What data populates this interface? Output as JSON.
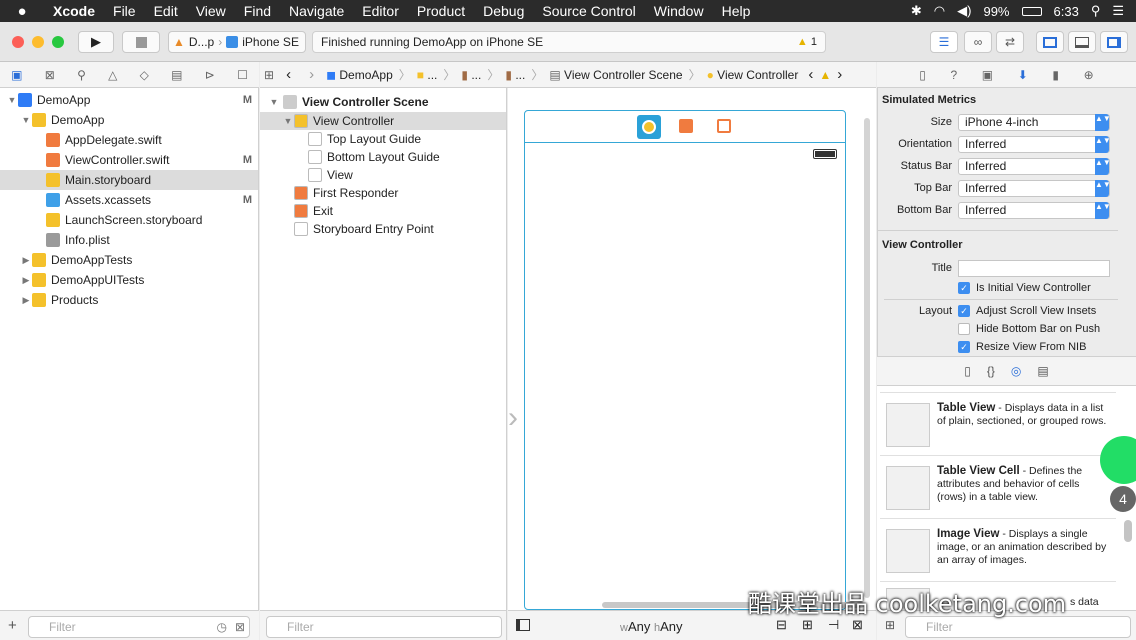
{
  "menubar": {
    "app": "Xcode",
    "items": [
      "File",
      "Edit",
      "View",
      "Find",
      "Navigate",
      "Editor",
      "Product",
      "Debug",
      "Source Control",
      "Window",
      "Help"
    ],
    "battery": "99%",
    "time": "6:33"
  },
  "toolbar": {
    "scheme": "D...p",
    "device": "iPhone SE",
    "status": "Finished running DemoApp on iPhone SE",
    "warnings": "1"
  },
  "navigator": {
    "items": [
      {
        "label": "DemoApp",
        "badge": "M",
        "indent": 0,
        "tri": "▼",
        "icon": "#2f7cf6"
      },
      {
        "label": "DemoApp",
        "badge": "",
        "indent": 1,
        "tri": "▼",
        "icon": "#f4c12b"
      },
      {
        "label": "AppDelegate.swift",
        "badge": "",
        "indent": 2,
        "tri": "",
        "icon": "#f07b3f"
      },
      {
        "label": "ViewController.swift",
        "badge": "M",
        "indent": 2,
        "tri": "",
        "icon": "#f07b3f"
      },
      {
        "label": "Main.storyboard",
        "badge": "",
        "indent": 2,
        "tri": "",
        "icon": "#f4c12b",
        "selected": true
      },
      {
        "label": "Assets.xcassets",
        "badge": "M",
        "indent": 2,
        "tri": "",
        "icon": "#3fa0e8"
      },
      {
        "label": "LaunchScreen.storyboard",
        "badge": "",
        "indent": 2,
        "tri": "",
        "icon": "#f4c12b"
      },
      {
        "label": "Info.plist",
        "badge": "",
        "indent": 2,
        "tri": "",
        "icon": "#9a9a9a"
      },
      {
        "label": "DemoAppTests",
        "badge": "",
        "indent": 1,
        "tri": "▶",
        "icon": "#f4c12b"
      },
      {
        "label": "DemoAppUITests",
        "badge": "",
        "indent": 1,
        "tri": "▶",
        "icon": "#f4c12b"
      },
      {
        "label": "Products",
        "badge": "",
        "indent": 1,
        "tri": "▶",
        "icon": "#f4c12b"
      }
    ],
    "filter": "Filter"
  },
  "jumpbar": {
    "items": [
      "DemoApp",
      "...",
      "...",
      "...",
      "View Controller Scene",
      "View Controller"
    ]
  },
  "outline": {
    "header": "View Controller Scene",
    "items": [
      {
        "label": "View Controller",
        "indent": 1,
        "tri": "▼",
        "icon": "#f4c12b",
        "selected": true
      },
      {
        "label": "Top Layout Guide",
        "indent": 2,
        "tri": "",
        "icon": "#ffffff"
      },
      {
        "label": "Bottom Layout Guide",
        "indent": 2,
        "tri": "",
        "icon": "#ffffff"
      },
      {
        "label": "View",
        "indent": 2,
        "tri": "",
        "icon": "#ffffff"
      },
      {
        "label": "First Responder",
        "indent": 1,
        "tri": "",
        "icon": "#f07b3f"
      },
      {
        "label": "Exit",
        "indent": 1,
        "tri": "",
        "icon": "#f07b3f"
      },
      {
        "label": "Storyboard Entry Point",
        "indent": 1,
        "tri": "",
        "icon": "#ffffff"
      }
    ],
    "filter": "Filter"
  },
  "canvas": {
    "size_w": "Any",
    "size_h": "Any",
    "w_prefix": "w",
    "h_prefix": "h"
  },
  "inspector": {
    "simulated_title": "Simulated Metrics",
    "metrics": [
      {
        "label": "Size",
        "value": "iPhone 4-inch"
      },
      {
        "label": "Orientation",
        "value": "Inferred"
      },
      {
        "label": "Status Bar",
        "value": "Inferred"
      },
      {
        "label": "Top Bar",
        "value": "Inferred"
      },
      {
        "label": "Bottom Bar",
        "value": "Inferred"
      }
    ],
    "vc_title": "View Controller",
    "title_label": "Title",
    "title_value": "",
    "initial_label": "Is Initial View Controller",
    "layout_label": "Layout",
    "layout_opts": [
      {
        "label": "Adjust Scroll View Insets",
        "on": true
      },
      {
        "label": "Hide Bottom Bar on Push",
        "on": false
      },
      {
        "label": "Resize View From NIB",
        "on": true
      }
    ]
  },
  "library": {
    "items": [
      {
        "name": "Table View",
        "desc": " - Displays data in a list of plain, sectioned, or grouped rows."
      },
      {
        "name": "Table View Cell",
        "desc": " - Defines the attributes and behavior of cells (rows) in a table view."
      },
      {
        "name": "Image View",
        "desc": " - Displays a single image, or an animation described by an array of images."
      }
    ],
    "partial": "s data",
    "filter": "Filter"
  },
  "overlay": {
    "badge": "4",
    "watermark": "酷课堂出品 coolketang.com"
  }
}
